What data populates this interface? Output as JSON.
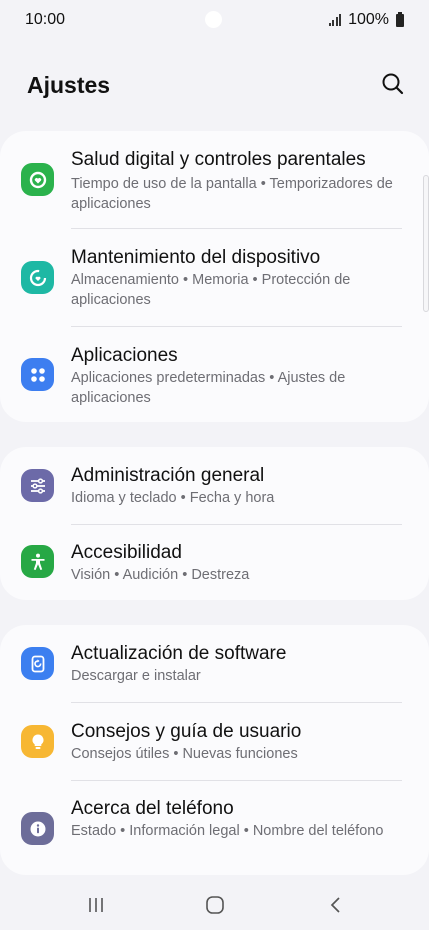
{
  "status": {
    "time": "10:00",
    "battery": "100%"
  },
  "header": {
    "title": "Ajustes"
  },
  "groups": [
    {
      "items": [
        {
          "title": "Salud digital y controles parentales",
          "subtitle": "Tiempo de uso de la pantalla  •  Temporizadores de aplicaciones",
          "icon": "digital-wellbeing-icon",
          "color": "#2bb24c"
        },
        {
          "title": "Mantenimiento del dispositivo",
          "subtitle": "Almacenamiento  •  Memoria  •  Protección de aplicaciones",
          "icon": "device-care-icon",
          "color": "#1eb8a4"
        },
        {
          "title": "Aplicaciones",
          "subtitle": "Aplicaciones predeterminadas  •  Ajustes de aplicaciones",
          "icon": "apps-icon",
          "color": "#3d7ef0"
        }
      ]
    },
    {
      "items": [
        {
          "title": "Administración general",
          "subtitle": "Idioma y teclado  •  Fecha y hora",
          "icon": "general-management-icon",
          "color": "#6c6aa8"
        },
        {
          "title": "Accesibilidad",
          "subtitle": "Visión  •  Audición  •  Destreza",
          "icon": "accessibility-icon",
          "color": "#27a845"
        }
      ]
    },
    {
      "items": [
        {
          "title": "Actualización de software",
          "subtitle": "Descargar e instalar",
          "icon": "software-update-icon",
          "color": "#3c7ff0"
        },
        {
          "title": "Consejos y guía de usuario",
          "subtitle": "Consejos útiles  •  Nuevas funciones",
          "icon": "tips-icon",
          "color": "#f7b733"
        },
        {
          "title": "Acerca del teléfono",
          "subtitle": "Estado  •  Información legal  •  Nombre del teléfono",
          "icon": "about-phone-icon",
          "color": "#6d6d99"
        }
      ]
    }
  ]
}
